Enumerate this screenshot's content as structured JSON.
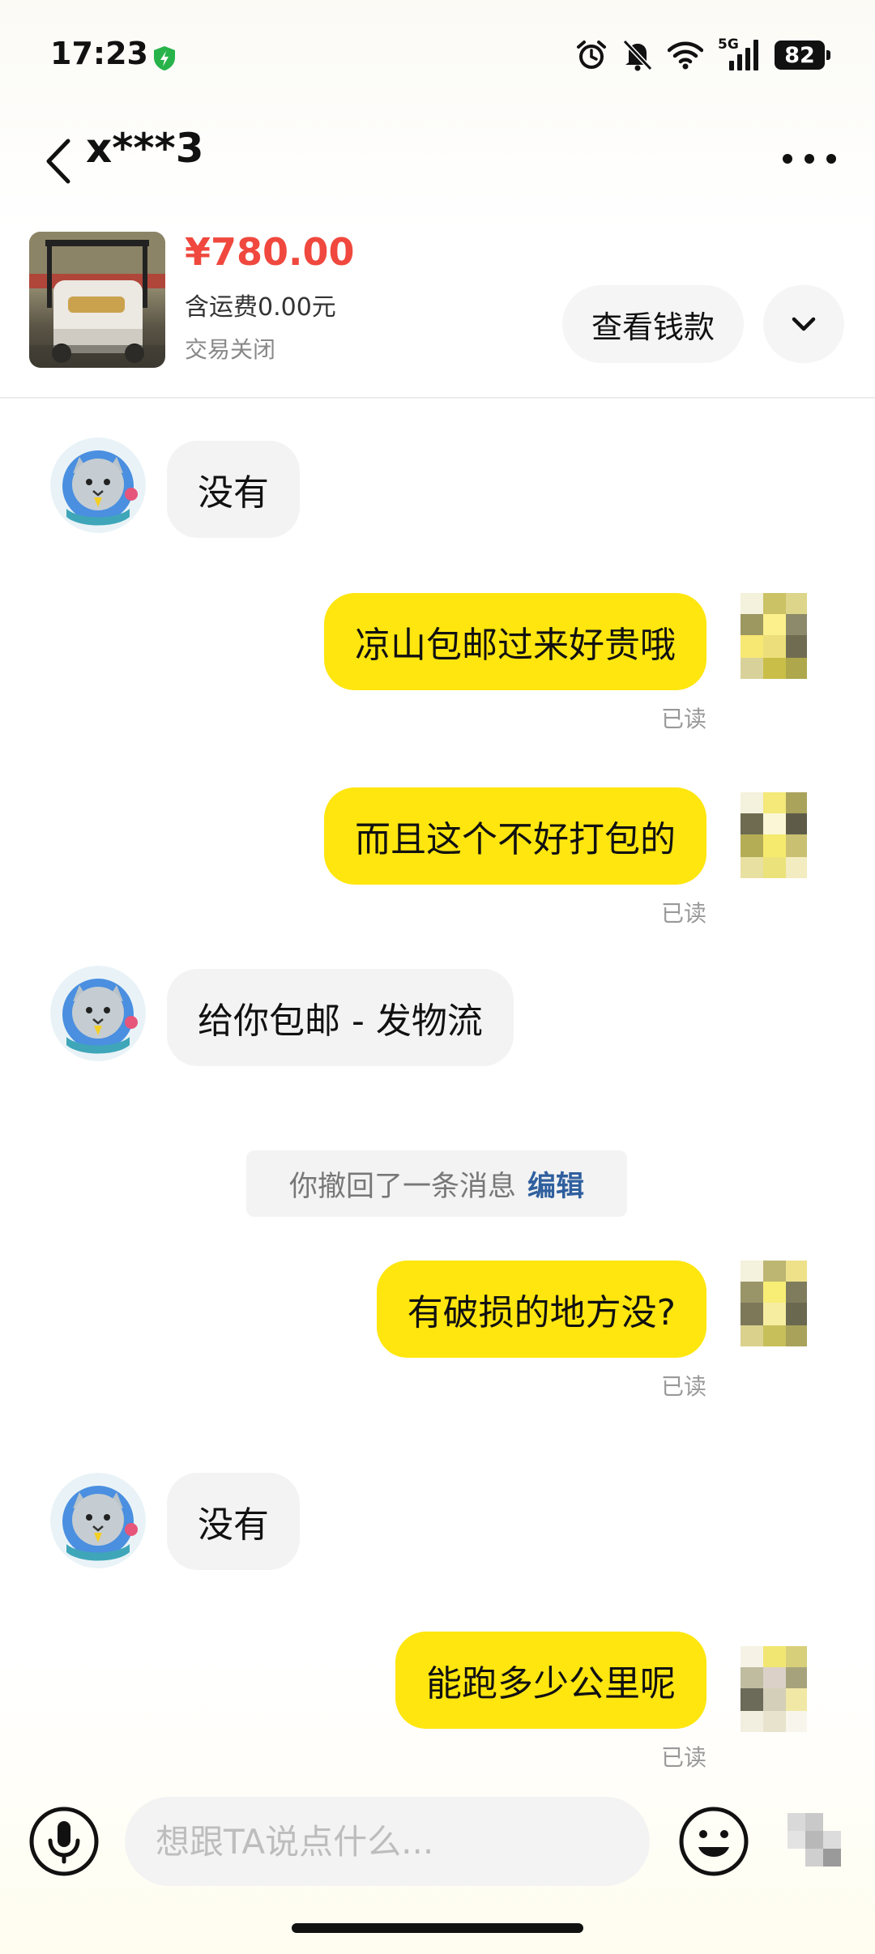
{
  "status_bar": {
    "time": "17:23",
    "network": "5G",
    "battery": "82",
    "icons": [
      "shield-charging-icon",
      "alarm-icon",
      "bell-off-icon",
      "wifi-icon",
      "signal-5g-icon",
      "battery-icon"
    ]
  },
  "header": {
    "name": "x***3",
    "back_icon": "chevron-left-icon",
    "more_icon": "more-horizontal-icon"
  },
  "product": {
    "price": "¥780.00",
    "shipping": "含运费0.00元",
    "status": "交易关闭",
    "view_button": "查看钱款",
    "expand_icon": "chevron-down-icon"
  },
  "messages": [
    {
      "side": "in",
      "text": "没有"
    },
    {
      "side": "out",
      "text": "凉山包邮过来好贵哦",
      "read": "已读"
    },
    {
      "side": "out",
      "text": "而且这个不好打包的",
      "read": "已读"
    },
    {
      "side": "in",
      "text": "给你包邮 - 发物流"
    },
    {
      "side": "system",
      "text": "你撤回了一条消息",
      "action": "编辑"
    },
    {
      "side": "out",
      "text": "有破损的地方没?",
      "read": "已读"
    },
    {
      "side": "in",
      "text": "没有"
    },
    {
      "side": "out",
      "text": "能跑多少公里呢",
      "read": "已读"
    }
  ],
  "input": {
    "placeholder": "想跟TA说点什么...",
    "value": "",
    "mic_icon": "microphone-icon",
    "emoji_icon": "smiley-icon"
  },
  "colors": {
    "accent_yellow": "#ffe60f",
    "price_red": "#f0483e",
    "link_blue": "#2f5f9e",
    "incoming_bubble": "#f3f3f3"
  }
}
